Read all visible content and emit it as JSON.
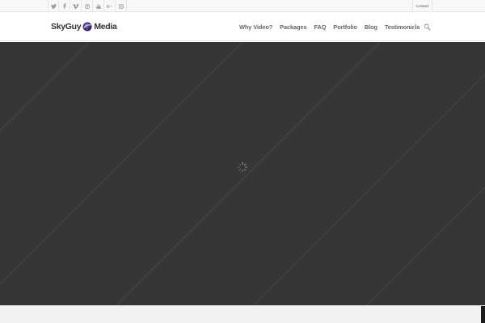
{
  "topbar": {
    "social_icons": [
      "twitter-icon",
      "facebook-icon",
      "vimeo-icon",
      "pinterest-icon",
      "youtube-icon",
      "google-plus-icon",
      "instagram-icon"
    ],
    "contact_label": "Contact"
  },
  "header": {
    "logo": {
      "left_text": "SkyGuy",
      "right_text": "Media",
      "emblem": "globe-icon"
    },
    "nav": [
      "Why Video?",
      "Packages",
      "FAQ",
      "Portfolio",
      "Blog",
      "Testimonials"
    ],
    "search_icon": "search-icon"
  },
  "hero": {
    "background_color": "#363636",
    "loader_icon": "loading-spinner-icon"
  },
  "colors": {
    "topbar_bg": "#f8f8f8",
    "nav_text": "#666666",
    "hero_bg": "#363636",
    "logo_accent": "#3b2b6e"
  }
}
